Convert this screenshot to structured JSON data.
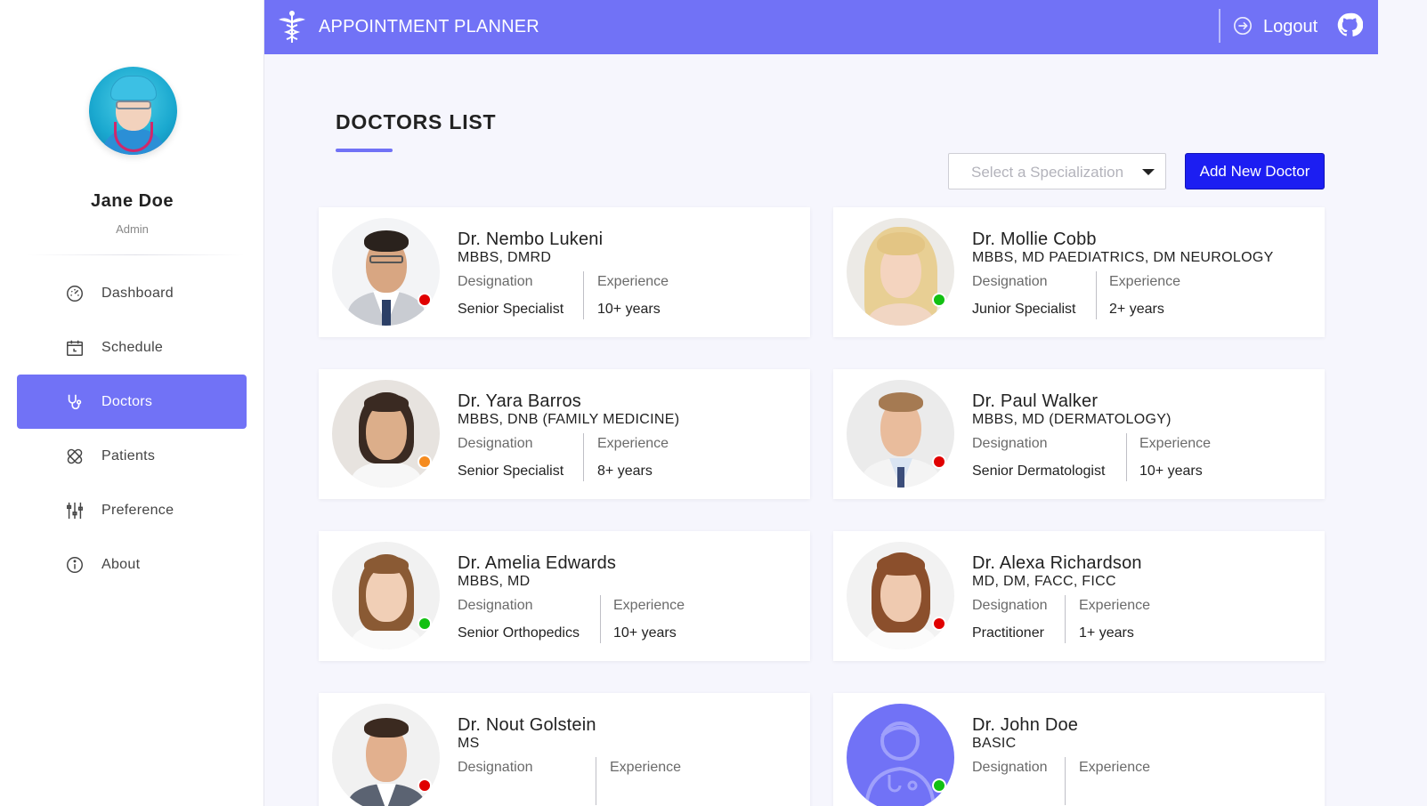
{
  "user": {
    "name": "Jane Doe",
    "role": "Admin"
  },
  "nav": {
    "items": [
      {
        "label": "Dashboard",
        "icon": "dashboard-gauge-icon"
      },
      {
        "label": "Schedule",
        "icon": "calendar-icon"
      },
      {
        "label": "Doctors",
        "icon": "stethoscope-icon",
        "active": true
      },
      {
        "label": "Patients",
        "icon": "bandage-icon"
      },
      {
        "label": "Preference",
        "icon": "sliders-icon"
      },
      {
        "label": "About",
        "icon": "info-icon"
      }
    ]
  },
  "header": {
    "title": "APPOINTMENT PLANNER",
    "logout_label": "Logout",
    "logo_icon": "caduceus-icon",
    "github_icon": "github-icon"
  },
  "main": {
    "page_title": "DOCTORS LIST",
    "specialization_placeholder": "Select a Specialization",
    "add_button_label": "Add New Doctor",
    "designation_header": "Designation",
    "experience_header": "Experience"
  },
  "colors": {
    "accent": "#7172f6",
    "primary_button": "#1c1ef2",
    "status_unavailable": "#e00000",
    "status_available": "#12c012",
    "status_busy": "#f58b1f"
  },
  "doctors": [
    {
      "name": "Dr. Nembo Lukeni",
      "qualification": "MBBS, DMRD",
      "designation": "Senior Specialist",
      "experience": "10+ years",
      "status": "unavailable"
    },
    {
      "name": "Dr. Mollie Cobb",
      "qualification": "MBBS, MD PAEDIATRICS, DM NEUROLOGY",
      "designation": "Junior Specialist",
      "experience": "2+ years",
      "status": "available"
    },
    {
      "name": "Dr. Yara Barros",
      "qualification": "MBBS, DNB (FAMILY MEDICINE)",
      "designation": "Senior Specialist",
      "experience": "8+ years",
      "status": "busy"
    },
    {
      "name": "Dr. Paul Walker",
      "qualification": "MBBS, MD (DERMATOLOGY)",
      "designation": "Senior Dermatologist",
      "experience": "10+ years",
      "status": "unavailable"
    },
    {
      "name": "Dr. Amelia Edwards",
      "qualification": "MBBS, MD",
      "designation": "Senior Orthopedics",
      "experience": "10+ years",
      "status": "available"
    },
    {
      "name": "Dr. Alexa Richardson",
      "qualification": "MD, DM, FACC, FICC",
      "designation": "Practitioner",
      "experience": "1+ years",
      "status": "unavailable"
    },
    {
      "name": "Dr. Nout Golstein",
      "qualification": "MS",
      "designation": "",
      "experience": "",
      "status": "unavailable"
    },
    {
      "name": "Dr. John Doe",
      "qualification": "BASIC",
      "designation": "",
      "experience": "",
      "status": "available"
    }
  ]
}
